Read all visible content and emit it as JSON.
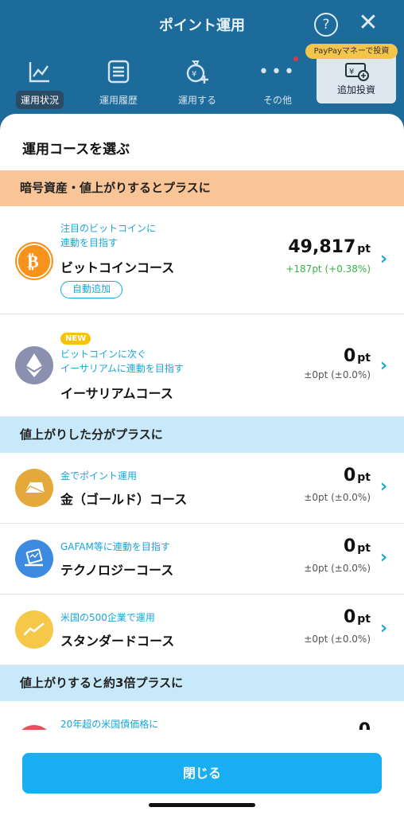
{
  "background": {
    "title": "ポイント運用",
    "nav": [
      "運用状況",
      "運用履歴",
      "運用する",
      "その他"
    ],
    "paypay_badge": "PayPayマネーで投資",
    "paypay_label": "追加投資"
  },
  "sheet": {
    "title": "運用コースを選ぶ",
    "sections": [
      "暗号資産・値上がりするとプラスに",
      "値上がりした分がプラスに",
      "値上がりすると約3倍プラスに"
    ],
    "items": [
      {
        "sub1": "注目のビットコインに",
        "sub2": "連動を目指す",
        "name": "ビットコインコース",
        "value": "49,817",
        "unit": "pt",
        "change": "+187pt (+0.38%)",
        "action": "自動追加",
        "icon": "bitcoin-icon",
        "color": "#f7931a"
      },
      {
        "badge": "NEW",
        "sub1": "ビットコインに次ぐ",
        "sub2": "イーサリアムに連動を目指す",
        "name": "イーサリアムコース",
        "value": "0",
        "unit": "pt",
        "change": "±0pt (±0.0%)",
        "icon": "ethereum-icon",
        "color": "#8b8fb0"
      },
      {
        "sub1": "金でポイント運用",
        "name": "金（ゴールド）コース",
        "value": "0",
        "unit": "pt",
        "change": "±0pt (±0.0%)",
        "icon": "gold-bar-icon",
        "color": "#e5a83a"
      },
      {
        "sub1": "GAFAM等に連動を目指す",
        "name": "テクノロジーコース",
        "value": "0",
        "unit": "pt",
        "change": "±0pt (±0.0%)",
        "icon": "laptop-icon",
        "color": "#3d8be0"
      },
      {
        "sub1": "米国の500企業で運用",
        "name": "スタンダードコース",
        "value": "0",
        "unit": "pt",
        "change": "±0pt (±0.0%)",
        "icon": "chart-up-icon",
        "color": "#f6c84a"
      },
      {
        "sub1": "20年超の米国債価格に",
        "value": "0",
        "icon": "bond-icon",
        "color": "#e8505b"
      }
    ],
    "close_label": "閉じる"
  }
}
